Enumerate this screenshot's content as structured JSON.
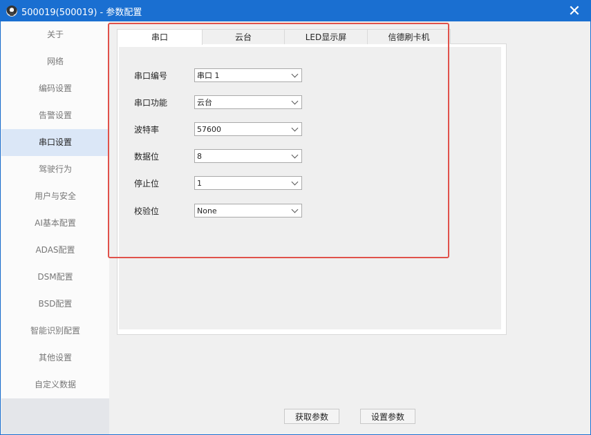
{
  "window": {
    "title": "500019(500019) - 参数配置",
    "close_glyph": "✕"
  },
  "sidebar": {
    "items": [
      {
        "label": "关于"
      },
      {
        "label": "网络"
      },
      {
        "label": "编码设置"
      },
      {
        "label": "告警设置"
      },
      {
        "label": "串口设置",
        "active": true
      },
      {
        "label": "驾驶行为"
      },
      {
        "label": "用户与安全"
      },
      {
        "label": "AI基本配置"
      },
      {
        "label": "ADAS配置"
      },
      {
        "label": "DSM配置"
      },
      {
        "label": "BSD配置"
      },
      {
        "label": "智能识别配置"
      },
      {
        "label": "其他设置"
      },
      {
        "label": "自定义数据"
      }
    ]
  },
  "tabs": [
    {
      "label": "串口",
      "active": true
    },
    {
      "label": "云台"
    },
    {
      "label": "LED显示屏"
    },
    {
      "label": "信德刷卡机"
    }
  ],
  "form": {
    "fields": [
      {
        "label": "串口编号",
        "value": "串口 1"
      },
      {
        "label": "串口功能",
        "value": "云台"
      },
      {
        "label": "波特率",
        "value": "57600"
      },
      {
        "label": "数据位",
        "value": "8"
      },
      {
        "label": "停止位",
        "value": "1"
      },
      {
        "label": "校验位",
        "value": "None"
      }
    ]
  },
  "buttons": {
    "get_params": "获取参数",
    "set_params": "设置参数"
  },
  "colors": {
    "titlebar": "#1a6fd1",
    "highlight": "#e0514a",
    "active_sidebar": "#dbe7f7"
  }
}
